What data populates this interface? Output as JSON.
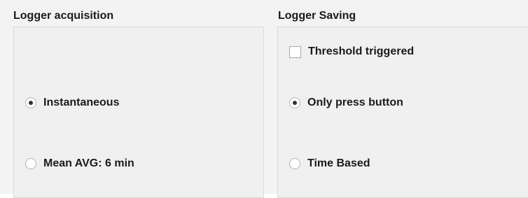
{
  "acquisition": {
    "title": "Logger acquisition",
    "options": [
      {
        "label": "Instantaneous",
        "selected": true
      },
      {
        "label": "Mean AVG: 6 min",
        "selected": false
      }
    ]
  },
  "saving": {
    "title": "Logger Saving",
    "threshold": {
      "label": "Threshold triggered",
      "checked": false
    },
    "options": [
      {
        "label": "Only press button",
        "selected": true
      },
      {
        "label": "Time Based",
        "selected": false
      }
    ]
  }
}
